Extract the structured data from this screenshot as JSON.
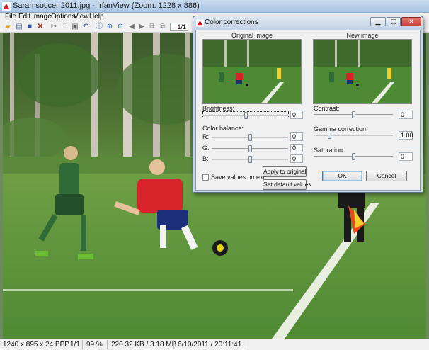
{
  "window": {
    "title": "Sarah soccer 2011.jpg - IrfanView (Zoom: 1228 x 886)",
    "icon": "irfanview-icon"
  },
  "menu": [
    "File",
    "Edit",
    "Image",
    "Options",
    "View",
    "Help"
  ],
  "toolbar": {
    "icons": [
      "open-folder-icon",
      "slideshow-icon",
      "save-icon",
      "delete-icon",
      "cut-icon",
      "copy-icon",
      "paste-icon",
      "undo-icon",
      "info-icon",
      "zoom-in-icon",
      "zoom-out-icon",
      "previous-icon",
      "next-icon",
      "first-page-icon",
      "last-page-icon"
    ],
    "page": "1/1"
  },
  "status": {
    "dimensions": "1240 x 895 x 24 BPP",
    "page": "1/1",
    "zoom": "99 %",
    "size": "220.32 KB / 3.18 MB",
    "datetime": "6/10/2011 / 20:11:41"
  },
  "dialog": {
    "title": "Color corrections",
    "original_label": "Original image",
    "new_label": "New image",
    "brightness": {
      "label": "Brightness:",
      "value": "0",
      "level": 0.5
    },
    "contrast": {
      "label": "Contrast:",
      "value": "0",
      "level": 0.5
    },
    "color_balance_label": "Color balance:",
    "red": {
      "label": "R:",
      "value": "0",
      "level": 0.5
    },
    "green": {
      "label": "G:",
      "value": "0",
      "level": 0.5
    },
    "blue": {
      "label": "B:",
      "value": "0",
      "level": 0.5
    },
    "gamma": {
      "label": "Gamma correction:",
      "value": "1.00",
      "level": 0.2
    },
    "saturation": {
      "label": "Saturation:",
      "value": "0",
      "level": 0.5
    },
    "save_on_exit": {
      "label": "Save values on exit",
      "checked": false
    },
    "apply_original": "Apply to original",
    "set_default": "Set default values",
    "ok": "OK",
    "cancel": "Cancel"
  },
  "colors": {
    "titlebar": "#b7cfe8",
    "dialog_frame": "#c9d7e7",
    "grass": "#4f8a34",
    "jersey_red": "#d9232b",
    "jersey_green": "#2f6b36",
    "close_button": "#c8433a"
  }
}
